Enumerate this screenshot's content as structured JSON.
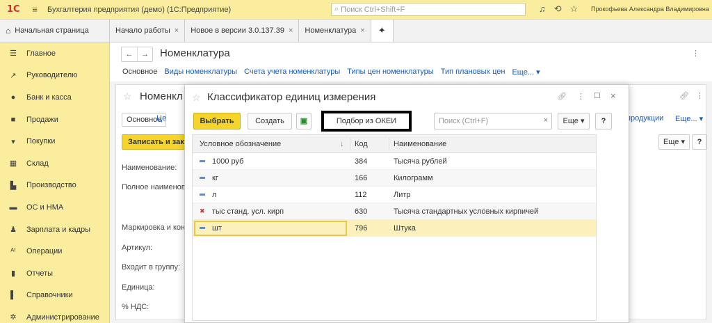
{
  "titlebar": {
    "logo": "1С",
    "app_title": "Бухгалтерия предприятия (демо)  (1С:Предприятие)",
    "search_placeholder": "Поиск Ctrl+Shift+F",
    "user": "Прокофьева Александра Владимировна"
  },
  "tabs": {
    "home": "Начальная страница",
    "items": [
      "Начало работы",
      "Новое в версии 3.0.137.39",
      "Номенклатура"
    ]
  },
  "sidebar": {
    "items": [
      {
        "label": "Главное",
        "icon": "menu-icon"
      },
      {
        "label": "Руководителю",
        "icon": "chart-line-icon"
      },
      {
        "label": "Банк и касса",
        "icon": "bank-icon"
      },
      {
        "label": "Продажи",
        "icon": "bag-icon"
      },
      {
        "label": "Покупки",
        "icon": "cart-icon"
      },
      {
        "label": "Склад",
        "icon": "warehouse-icon"
      },
      {
        "label": "Производство",
        "icon": "factory-icon"
      },
      {
        "label": "ОС и НМА",
        "icon": "truck-icon"
      },
      {
        "label": "Зарплата и кадры",
        "icon": "person-icon"
      },
      {
        "label": "Операции",
        "icon": "operations-icon"
      },
      {
        "label": "Отчеты",
        "icon": "bar-chart-icon"
      },
      {
        "label": "Справочники",
        "icon": "book-icon"
      },
      {
        "label": "Администрирование",
        "icon": "gear-icon"
      }
    ]
  },
  "main": {
    "title": "Номенклатура",
    "subnav": {
      "active": "Основное",
      "links": [
        "Виды номенклатуры",
        "Счета учета номенклатуры",
        "Типы цен номенклатуры",
        "Тип плановых цен",
        "Еще... ▾"
      ]
    }
  },
  "inner": {
    "title": "Номенкл",
    "tab_basic": "Основное",
    "tab_link": "Це",
    "right_link": "продукции",
    "right_more": "Еще... ▾",
    "save_button": "Записать и зак",
    "more_button": "Еще ▾",
    "help_button": "?",
    "labels": [
      "Наименование:",
      "Полное наименов",
      "Маркировка и кон",
      "Артикул:",
      "Входит в группу:",
      "Единица:",
      "% НДС:"
    ]
  },
  "dialog": {
    "title": "Классификатор единиц измерения",
    "buttons": {
      "select": "Выбрать",
      "create": "Создать",
      "okei": "Подбор из ОКЕИ",
      "more": "Еще ▾",
      "help": "?"
    },
    "search_placeholder": "Поиск (Ctrl+F)",
    "columns": [
      "Условное обозначение",
      "Код",
      "Наименование"
    ],
    "rows": [
      {
        "symbol": "1000 руб",
        "code": "384",
        "name": "Тысяча рублей",
        "marked": false
      },
      {
        "symbol": "кг",
        "code": "166",
        "name": "Килограмм",
        "marked": false
      },
      {
        "symbol": "л",
        "code": "112",
        "name": "Литр",
        "marked": false
      },
      {
        "symbol": "тыс станд. усл. кирп",
        "code": "630",
        "name": "Тысяча стандартных условных кирпичей",
        "marked": true
      },
      {
        "symbol": "шт",
        "code": "796",
        "name": "Штука",
        "marked": false
      }
    ],
    "selected_row": 4
  }
}
